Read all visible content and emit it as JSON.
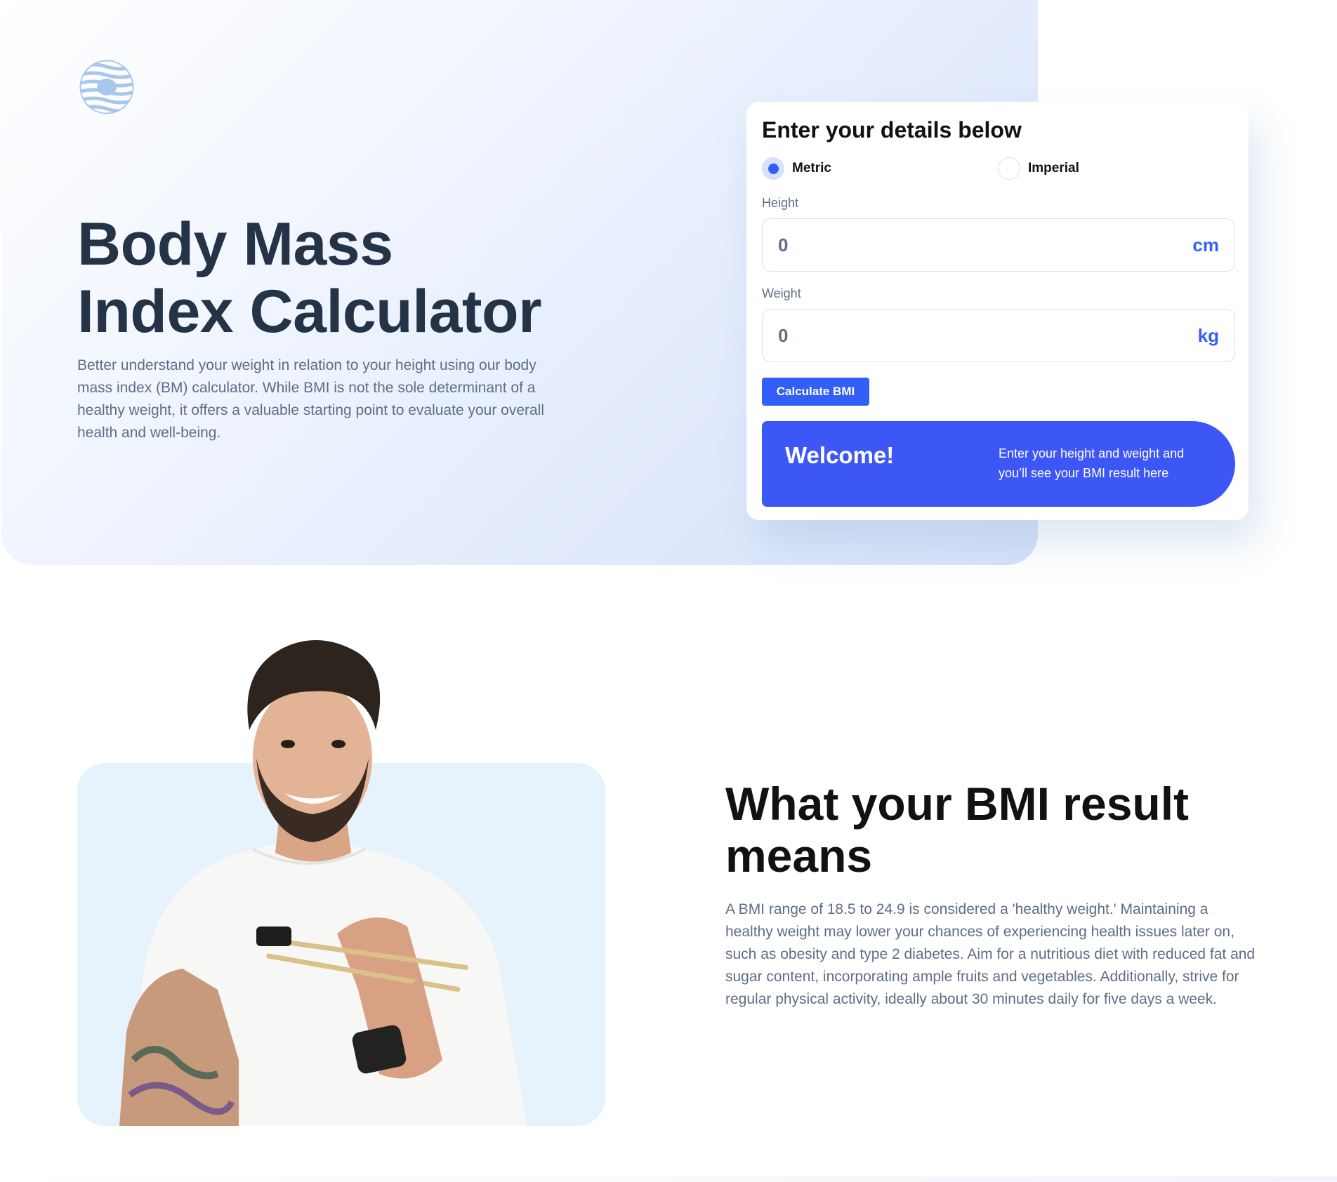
{
  "logo": {
    "icon": "striped-circle-logo-icon",
    "color": "#9fc0ee"
  },
  "hero": {
    "title_line1": "Body Mass",
    "title_line2": "Index Calculator",
    "description": "Better understand your weight in relation to your height using our body mass index (BM) calculator. While BMI is not the sole determinant of a healthy weight, it offers a valuable starting point to evaluate your overall health and well-being."
  },
  "form": {
    "title": "Enter your details below",
    "units": [
      {
        "label": "Metric",
        "selected": true
      },
      {
        "label": "Imperial",
        "selected": false
      }
    ],
    "height": {
      "label": "Height",
      "value": "0",
      "unit": "cm"
    },
    "weight": {
      "label": "Weight",
      "value": "0",
      "unit": "kg"
    },
    "calculate_label": "Calculate BMI",
    "result": {
      "title": "Welcome!",
      "text": "Enter your height and weight and you’ll see your BMI result here"
    }
  },
  "meaning": {
    "title": "What your BMI result means",
    "description": "A BMI range of 18.5 to 24.9 is considered a 'healthy weight.' Maintaining a healthy weight may lower your chances of experiencing health issues later on, such as obesity and type 2 diabetes. Aim for a nutritious diet with reduced fat and sugar content, incorporating ample fruits and vegetables. Additionally, strive for regular physical activity, ideally about 30 minutes daily for five days a week."
  },
  "colors": {
    "accent": "#345ff6",
    "result_bg": "#3d57f7",
    "heading": "#253347",
    "body_text": "#5e6e85",
    "photo_bg": "#e6f2fc"
  }
}
